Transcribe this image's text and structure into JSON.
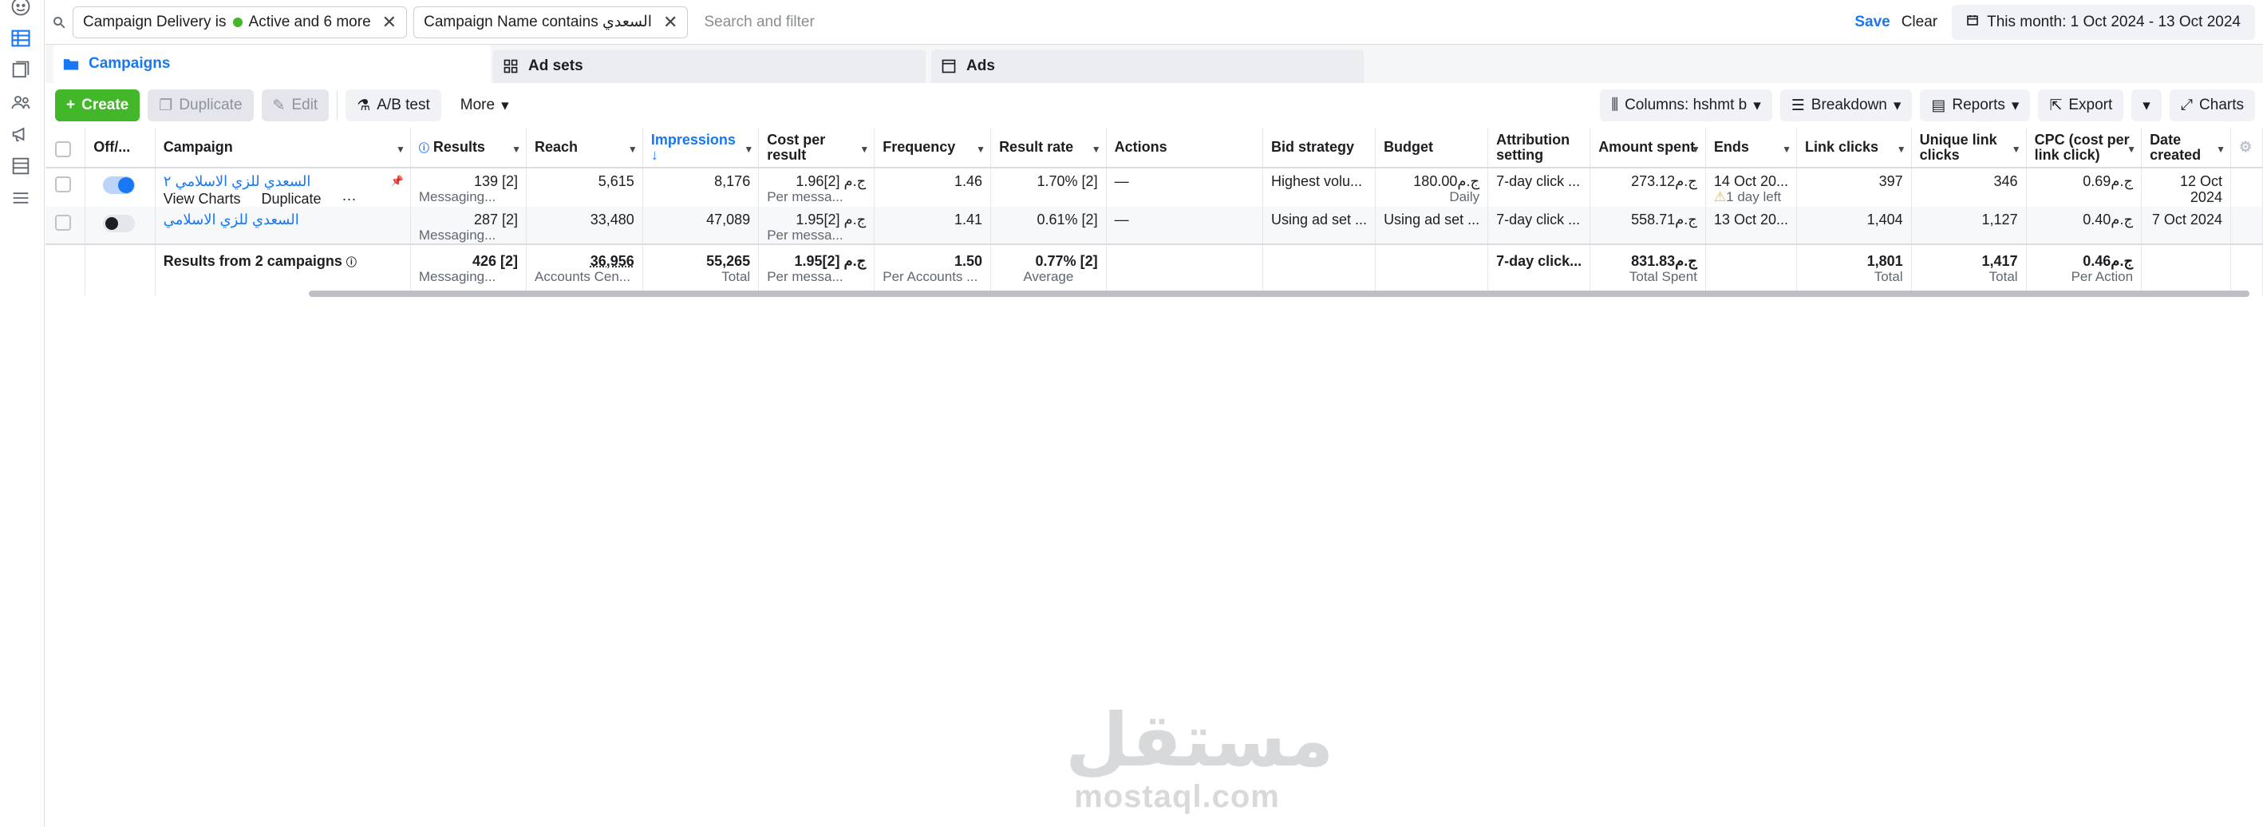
{
  "filters": {
    "chip1_prefix": "Campaign Delivery is",
    "chip1_value": "Active and 6 more",
    "chip2_prefix": "Campaign Name contains",
    "chip2_value": "السعدي",
    "search_placeholder": "Search and filter",
    "save": "Save",
    "clear": "Clear",
    "date_range": "This month: 1 Oct 2024 - 13 Oct 2024"
  },
  "tabs": {
    "campaigns": "Campaigns",
    "adsets": "Ad sets",
    "ads": "Ads"
  },
  "toolbar": {
    "create": "Create",
    "duplicate": "Duplicate",
    "edit": "Edit",
    "abtest": "A/B test",
    "more": "More",
    "columns": "Columns: hshmt b",
    "breakdown": "Breakdown",
    "reports": "Reports",
    "export": "Export",
    "charts": "Charts"
  },
  "headers": {
    "offon": "Off/...",
    "campaign": "Campaign",
    "results": "Results",
    "reach": "Reach",
    "impressions": "Impressions",
    "cost": "Cost per result",
    "frequency": "Frequency",
    "result_rate": "Result rate",
    "actions": "Actions",
    "bid": "Bid strategy",
    "budget": "Budget",
    "attribution": "Attribution setting",
    "amount": "Amount spent",
    "ends": "Ends",
    "link_clicks": "Link clicks",
    "unique": "Unique link clicks",
    "cpc": "CPC (cost per link click)",
    "date_created": "Date created"
  },
  "rows": [
    {
      "name": "السعدي للزي الاسلامي ٢",
      "view_charts": "View Charts",
      "duplicate": "Duplicate",
      "more": "···",
      "results": "139 [2]",
      "results_sub": "Messaging...",
      "reach": "5,615",
      "impressions": "8,176",
      "cost": "1.96ج.م [2]",
      "cost_sub": "Per messa...",
      "frequency": "1.46",
      "result_rate": "1.70% [2]",
      "actions": "—",
      "bid": "Highest volu...",
      "budget": "180.00ج.م",
      "budget_sub": "Daily",
      "attribution": "7-day click ...",
      "amount": "273.12ج.م",
      "ends": "14 Oct 20...",
      "ends_sub": "1 day left",
      "link_clicks": "397",
      "unique": "346",
      "cpc": "0.69ج.م",
      "date_created": "12 Oct 2024"
    },
    {
      "name": "السعدي للزي الاسلامي",
      "results": "287 [2]",
      "results_sub": "Messaging...",
      "reach": "33,480",
      "impressions": "47,089",
      "cost": "1.95ج.م [2]",
      "cost_sub": "Per messa...",
      "frequency": "1.41",
      "result_rate": "0.61% [2]",
      "actions": "—",
      "bid": "Using ad set ...",
      "budget": "Using ad set ...",
      "attribution": "7-day click ...",
      "amount": "558.71ج.م",
      "ends": "13 Oct 20...",
      "link_clicks": "1,404",
      "unique": "1,127",
      "cpc": "0.40ج.م",
      "date_created": "7 Oct 2024"
    }
  ],
  "totals": {
    "label": "Results from 2 campaigns",
    "results": "426 [2]",
    "results_sub": "Messaging...",
    "reach": "36,956",
    "reach_sub": "Accounts Cen...",
    "impressions": "55,265",
    "impressions_sub": "Total",
    "cost": "1.95ج.م [2]",
    "cost_sub": "Per messa...",
    "frequency": "1.50",
    "frequency_sub": "Per Accounts ...",
    "result_rate": "0.77% [2]",
    "result_rate_sub": "Average",
    "attribution": "7-day click...",
    "amount": "831.83ج.م",
    "amount_sub": "Total Spent",
    "link_clicks": "1,801",
    "link_clicks_sub": "Total",
    "unique": "1,417",
    "unique_sub": "Total",
    "cpc": "0.46ج.م",
    "cpc_sub": "Per Action"
  },
  "watermark": {
    "arabic": "مستقل",
    "latin": "mostaql.com"
  },
  "colors": {
    "accent": "#1877f2",
    "create": "#42b72a",
    "active_dot": "#42b72a"
  }
}
